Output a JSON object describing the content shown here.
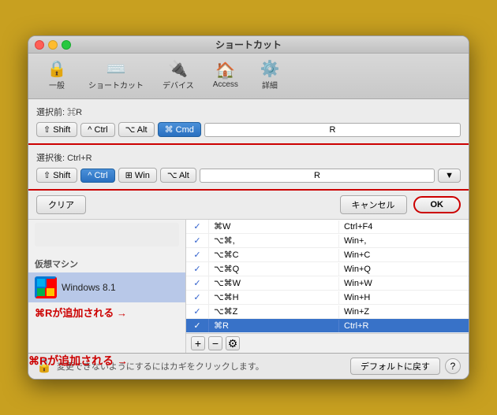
{
  "window": {
    "title": "ショートカット",
    "traffic_lights": [
      "close",
      "minimize",
      "maximize"
    ]
  },
  "toolbar": {
    "items": [
      {
        "id": "general",
        "icon": "🔒",
        "label": "一般"
      },
      {
        "id": "shortcuts",
        "icon": "⌨️",
        "label": "ショートカット"
      },
      {
        "id": "devices",
        "icon": "🔌",
        "label": "デバイス"
      },
      {
        "id": "access",
        "icon": "🏠",
        "label": "Access"
      },
      {
        "id": "details",
        "icon": "⚙️",
        "label": "詳細"
      }
    ]
  },
  "shortcut_before": {
    "label": "選択前: ⌘R",
    "keys": [
      "⇧ Shift",
      "^ Ctrl",
      "⌥ Alt",
      "⌘ Cmd"
    ],
    "active_key": "⌘ Cmd",
    "value": "R"
  },
  "shortcut_after": {
    "label": "選択後: Ctrl+R",
    "keys": [
      "⇧ Shift",
      "^ Ctrl",
      "⊞ Win",
      "⌥ Alt"
    ],
    "active_key": "^ Ctrl",
    "value": "R"
  },
  "buttons": {
    "clear": "クリア",
    "cancel": "キャンセル",
    "ok": "OK"
  },
  "vm_section": {
    "label": "仮想マシン",
    "vm_name": "Windows 8.1"
  },
  "annotation": {
    "text": "⌘Rが追加される →"
  },
  "table": {
    "rows": [
      {
        "checked": true,
        "shortcut": "⌘W",
        "action": "Ctrl+F4",
        "selected": false
      },
      {
        "checked": true,
        "shortcut": "⌥⌘,",
        "action": "Win+,",
        "selected": false
      },
      {
        "checked": true,
        "shortcut": "⌥⌘C",
        "action": "Win+C",
        "selected": false
      },
      {
        "checked": true,
        "shortcut": "⌥⌘Q",
        "action": "Win+Q",
        "selected": false
      },
      {
        "checked": true,
        "shortcut": "⌥⌘W",
        "action": "Win+W",
        "selected": false
      },
      {
        "checked": true,
        "shortcut": "⌥⌘H",
        "action": "Win+H",
        "selected": false
      },
      {
        "checked": true,
        "shortcut": "⌥⌘Z",
        "action": "Win+Z",
        "selected": false
      },
      {
        "checked": true,
        "shortcut": "⌘R",
        "action": "Ctrl+R",
        "selected": true
      }
    ]
  },
  "bottom_bar": {
    "lock_text": "変更できないようにするにはカギをクリックします。",
    "default_btn": "デフォルトに戻す",
    "help": "?"
  }
}
